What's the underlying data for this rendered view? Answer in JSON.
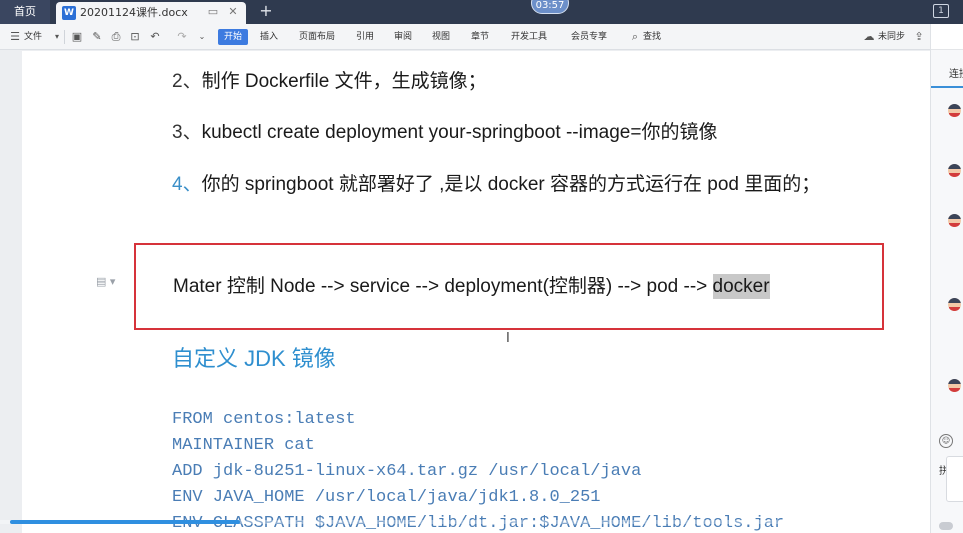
{
  "titlebar": {
    "home_tab": "首页",
    "doc_tab": "20201124课件.docx",
    "doc_icon": "W",
    "timer": "03:57",
    "new_tab": "+"
  },
  "ribbon": {
    "file": "文件",
    "start": "开始",
    "tabs": [
      "插入",
      "页面布局",
      "引用",
      "审阅",
      "视图",
      "章节",
      "开发工具",
      "会员专享"
    ],
    "search": "查找",
    "sync": "未同步"
  },
  "document": {
    "para2": {
      "num": "2、",
      "text": "制作 Dockerfile 文件，生成镜像；"
    },
    "para3": {
      "num": "3、",
      "text": "kubectl create deployment your-springboot --image=你的镜像"
    },
    "para4": {
      "num": "4、",
      "text": "你的 springboot 就部署好了 ,是以 docker 容器的方式运行在 pod 里面的；"
    },
    "flow_text": "Mater 控制 Node --> service --> deployment(控制器) --> pod --> ",
    "flow_highlight": "docker",
    "heading": "自定义 JDK 镜像",
    "code": [
      "FROM centos:latest",
      "MAINTAINER cat",
      "ADD jdk-8u251-linux-x64.tar.gz /usr/local/java",
      "ENV JAVA_HOME /usr/local/java/jdk1.8.0_251",
      "ENV CLASSPATH $JAVA_HOME/lib/dt.jar:$JAVA_HOME/lib/tools.jar"
    ]
  },
  "sidebar": {
    "label": "连接",
    "send": "拼"
  },
  "progress": {
    "fraction": 0.25
  },
  "colors": {
    "accent": "#3d7be0",
    "heading": "#2f8fcf",
    "code": "#4a7db5",
    "box_border": "#d6333a"
  }
}
